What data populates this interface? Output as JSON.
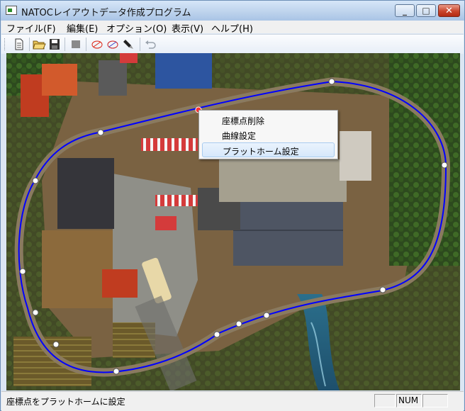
{
  "window": {
    "title": "NATOCレイアウトデータ作成プログラム"
  },
  "menu": {
    "items": [
      "ファイル(F)",
      "編集(E)",
      "オプション(O)",
      "表示(V)",
      "ヘルプ(H)"
    ]
  },
  "toolbar": {
    "buttons": [
      "new-document",
      "open-folder",
      "save",
      "stop",
      "draw-curve",
      "edit-curve",
      "brush",
      "undo"
    ]
  },
  "canvas": {
    "image_description_icon": "model-railway-layout-photo",
    "track_color": "#0000ff",
    "node_color": "#ffffff",
    "selected_node_color": "#ff0000"
  },
  "context_menu": {
    "items": [
      "座標点削除",
      "曲線設定",
      "プラットホーム設定"
    ],
    "highlighted_index": 2
  },
  "status": {
    "text": "座標点をプラットホームに設定",
    "pane1": "",
    "pane2": "NUM",
    "pane3": ""
  }
}
